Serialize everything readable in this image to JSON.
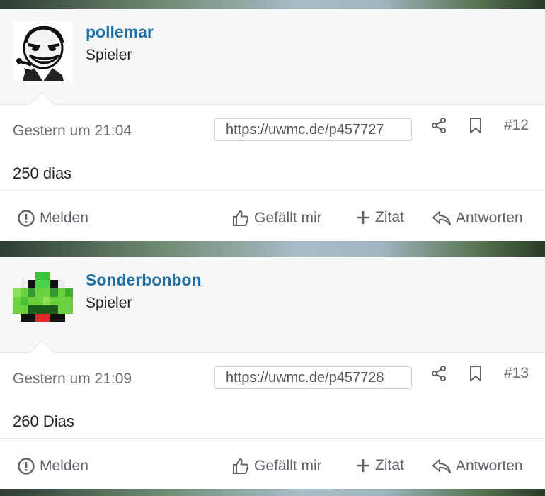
{
  "posts": [
    {
      "username": "pollemar",
      "role": "Spieler",
      "avatar": "troll-face-avatar",
      "date": "Gestern um 21:04",
      "permalink": "https://uwmc.de/p457727",
      "number": "#12",
      "content": "250 dias"
    },
    {
      "username": "Sonderbonbon",
      "role": "Spieler",
      "avatar": "green-pixel-creature-avatar",
      "date": "Gestern um 21:09",
      "permalink": "https://uwmc.de/p457728",
      "number": "#13",
      "content": "260 Dias"
    }
  ],
  "actions": {
    "report": "Melden",
    "like": "Gefällt mir",
    "quote": "Zitat",
    "reply": "Antworten"
  },
  "icons": {
    "report": "exclamation-circle-icon",
    "like": "thumbs-up-icon",
    "quote": "plus-icon",
    "reply": "reply-arrow-icon",
    "share": "share-icon",
    "bookmark": "bookmark-icon"
  },
  "colors": {
    "username": "#1f6fa3",
    "muted_text": "#6b6f75",
    "author_bg": "#f7f8fa"
  }
}
